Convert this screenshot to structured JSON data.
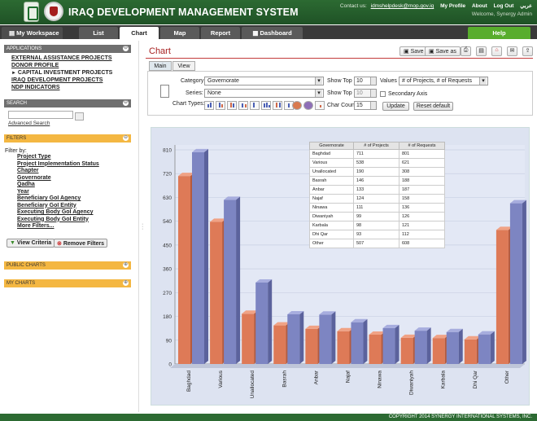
{
  "header": {
    "app_title": "IRAQ DEVELOPMENT MANAGEMENT SYSTEM",
    "contact_label": "Contact us:",
    "contact_email": "idmshelpdesk@mop.gov.iq",
    "my_profile": "My Profile",
    "about": "About",
    "log_out": "Log Out",
    "arabic": "عربي",
    "welcome": "Welcome, Synergy Admin"
  },
  "nav": {
    "workspace": "My Workspace",
    "tabs": [
      "List",
      "Chart",
      "Map",
      "Report",
      "Dashboard"
    ],
    "help": "Help"
  },
  "sidebar": {
    "applications_title": "APPLICATIONS",
    "applications": [
      "EXTERNAL ASSISTANCE PROJECTS",
      "DONOR PROFILE",
      "CAPITAL INVESTMENT PROJECTS",
      "IRAQ DEVELOPMENT PROJECTS",
      "NDP INDICATORS"
    ],
    "search_title": "SEARCH",
    "advanced_search": "Advanced Search",
    "filters_title": "FILTERS",
    "filter_by": "Filter by:",
    "filters": [
      "Project Type",
      "Project Implementation Status",
      "Chapter",
      "Governorate",
      "Qadha",
      "Year",
      "Beneficiary GoI Agency",
      "Beneficiary GoI Entity",
      "Executing Body GoI Agency",
      "Executing Body GoI Entity",
      "More Filters..."
    ],
    "view_criteria": "View Criteria",
    "remove_filters": "Remove Filters",
    "public_charts": "PUBLIC CHARTS",
    "my_charts": "MY CHARTS"
  },
  "main": {
    "title": "Chart",
    "save": "Save",
    "save_as": "Save as",
    "subtabs": [
      "Main",
      "View"
    ],
    "category_label": "Category:",
    "category_value": "Governorate",
    "series_label": "Series:",
    "series_value": "None",
    "chart_types_label": "Chart Types:",
    "show_top_label": "Show Top",
    "show_top_value": "10",
    "show_top_2_label": "Show Top",
    "show_top_2_value": "10",
    "values_label": "Values",
    "values_value": "# of Projects, # of Requests",
    "secondary_axis": "Secondary Axis",
    "char_count_label": "Char Count",
    "char_count_value": "15",
    "update": "Update",
    "reset_default": "Reset default"
  },
  "table": {
    "headers": [
      "Governorate",
      "# of Projects",
      "# of Requests"
    ],
    "rows": [
      [
        "Baghdad",
        "711",
        "801"
      ],
      [
        "Various",
        "538",
        "621"
      ],
      [
        "Unallocated",
        "190",
        "308"
      ],
      [
        "Basrah",
        "146",
        "188"
      ],
      [
        "Anbar",
        "133",
        "187"
      ],
      [
        "Najaf",
        "124",
        "158"
      ],
      [
        "Ninawa",
        "111",
        "136"
      ],
      [
        "Diwaniyah",
        "99",
        "126"
      ],
      [
        "Karbala",
        "98",
        "121"
      ],
      [
        "Dhi Qar",
        "93",
        "112"
      ],
      [
        "Other",
        "507",
        "608"
      ]
    ]
  },
  "chart_data": {
    "type": "bar",
    "categories": [
      "Baghdad",
      "Various",
      "Unallocated",
      "Basrah",
      "Anbar",
      "Najaf",
      "Ninawa",
      "Diwaniyah",
      "Karbala",
      "Dhi Qar",
      "Other"
    ],
    "series": [
      {
        "name": "# of Projects",
        "values": [
          711,
          538,
          190,
          146,
          133,
          124,
          111,
          99,
          98,
          93,
          507
        ]
      },
      {
        "name": "# of Requests",
        "values": [
          801,
          621,
          308,
          188,
          187,
          158,
          136,
          126,
          121,
          112,
          608
        ]
      }
    ],
    "yticks": [
      "0",
      "90",
      "180",
      "270",
      "360",
      "450",
      "540",
      "630",
      "720",
      "810"
    ],
    "ylim": [
      0,
      810
    ],
    "colors": {
      "projects": "#e07b5a",
      "requests": "#7e86c2"
    },
    "grid": true,
    "legend": "data table top-center"
  },
  "footer": "COPYRIGHT 2014 SYNERGY INTERNATIONAL SYSTEMS, INC."
}
